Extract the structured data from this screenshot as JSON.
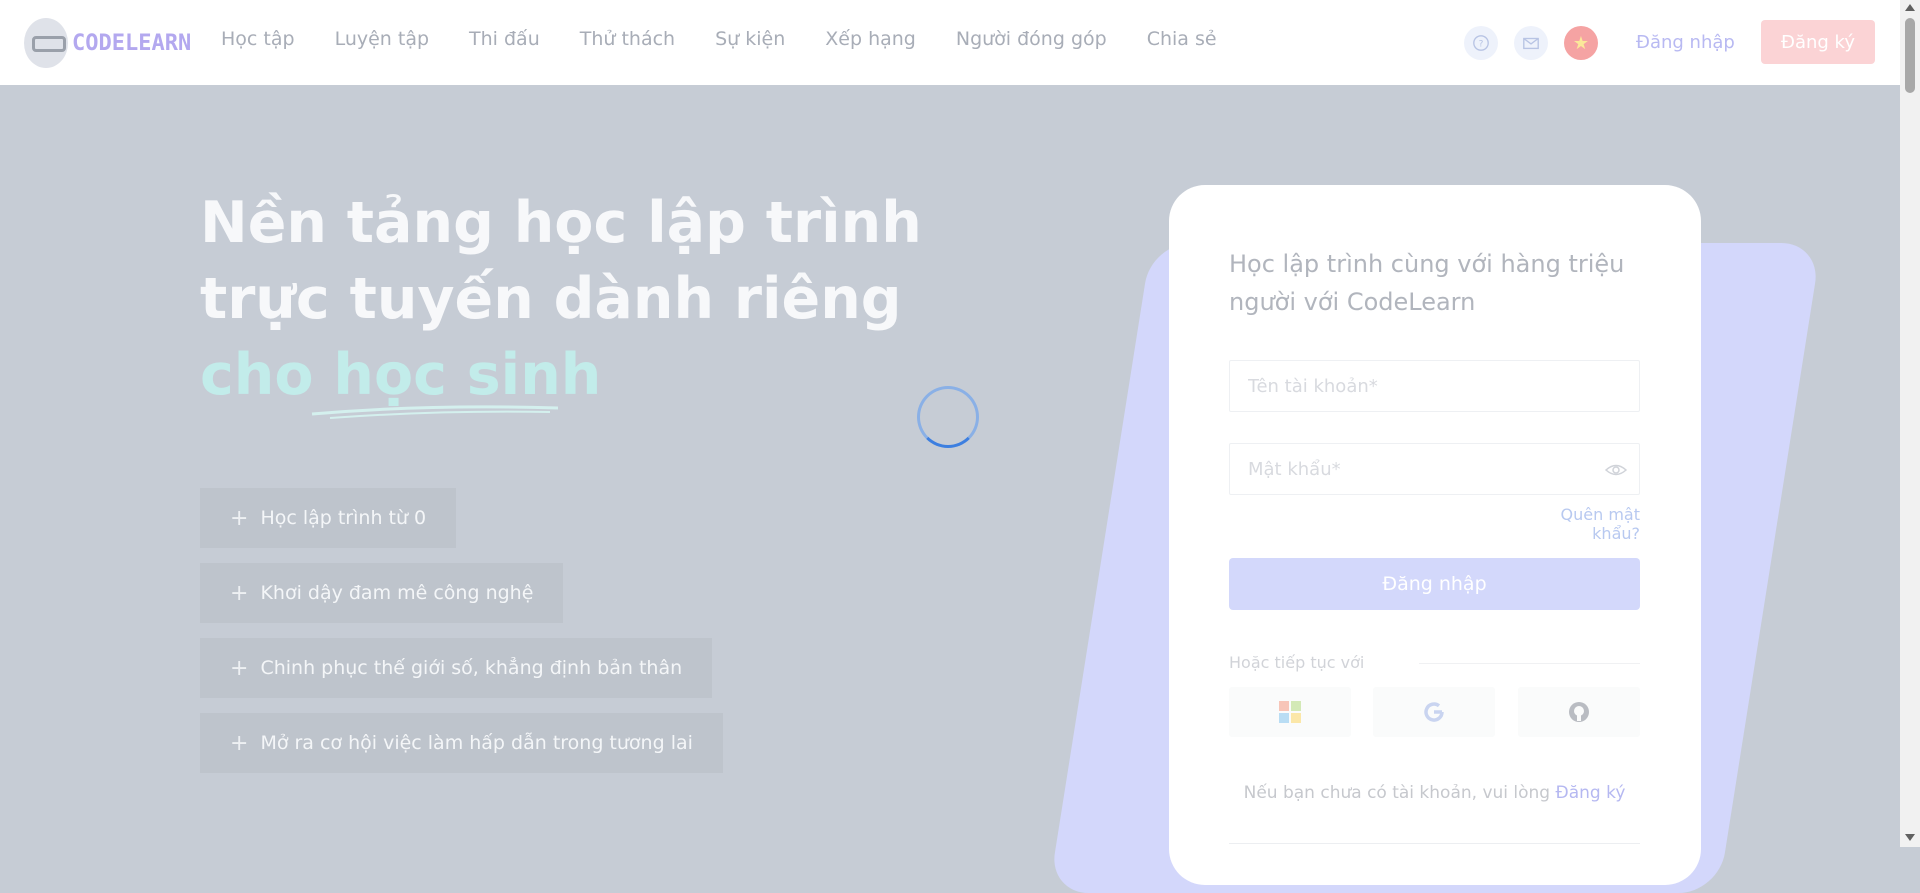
{
  "header": {
    "logo_text": "CODELEARN",
    "nav": [
      "Học tập",
      "Luyện tập",
      "Thi đấu",
      "Thử thách",
      "Sự kiện",
      "Xếp hạng",
      "Người đóng góp",
      "Chia sẻ"
    ],
    "login_label": "Đăng nhập",
    "signup_label": "Đăng ký",
    "flag_glyph": "★"
  },
  "hero": {
    "title_line1": "Nền tảng học lập trình",
    "title_line2": "trực tuyến dành riêng",
    "title_line3": "cho học sinh",
    "features": [
      "Học lập trình từ 0",
      "Khơi dậy đam mê công nghệ",
      "Chinh phục thế giới số, khẳng định bản thân",
      "Mở ra cơ hội việc làm hấp dẫn trong tương lai"
    ],
    "plus_glyph": "+"
  },
  "login_card": {
    "title": "Học lập trình cùng với hàng triệu người với CodeLearn",
    "username_placeholder": "Tên tài khoản*",
    "password_placeholder": "Mật khẩu*",
    "forgot_label": "Quên mật khẩu?",
    "login_label": "Đăng nhập",
    "or_label": "Hoặc tiếp tục với",
    "signup_prompt": "Nếu bạn chưa có tài khoản, vui lòng",
    "signup_link": "Đăng ký"
  },
  "colors": {
    "overlay": "#c6ccd5",
    "accent": "#c2ecea",
    "brand": "#b3a8ef"
  }
}
